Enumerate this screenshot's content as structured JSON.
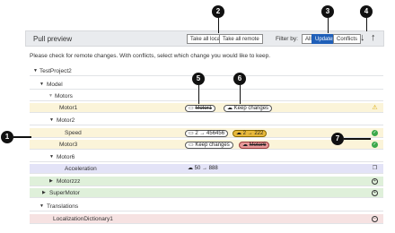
{
  "toolbar": {
    "title": "Pull preview",
    "take_all_local": "Take all local",
    "take_all_remote": "Take all remote",
    "filter_label": "Filter by:",
    "filters": [
      "All",
      "Updates",
      "Conflicts"
    ],
    "active_filter": "Updates",
    "down_arrow": "↓",
    "up_arrow": "↑"
  },
  "info_text": "Please check for remote changes. With conflicts, select which change you would like to keep.",
  "rows": [
    {
      "label": "TestProject2"
    },
    {
      "label": "Model"
    },
    {
      "label": "Motors"
    },
    {
      "label": "Motor1",
      "keep_local": "Motor1",
      "keep_changes": "Keep changes"
    },
    {
      "label": "Motor2"
    },
    {
      "label": "Speed",
      "local_value": "2 → 456456",
      "remote_value": "2 → 222"
    },
    {
      "label": "Motor3",
      "keep_changes": "Keep changes",
      "keep_remote": "Motor6"
    },
    {
      "label": "Motor6"
    },
    {
      "label": "Acceleration",
      "change": "50 → 888"
    },
    {
      "label": "Motorzzz"
    },
    {
      "label": "SuperMotor"
    },
    {
      "label": "Translations"
    },
    {
      "label": "LocalizationDictionary1"
    }
  ],
  "callouts": [
    "1",
    "2",
    "3",
    "4",
    "5",
    "6",
    "7"
  ],
  "colors": {
    "active_filter": "#1f5fb8",
    "conflict_row": "#fbf4d9",
    "modified_row": "#e3e3f7",
    "added_row": "#dff0da",
    "deleted_row": "#f6e2e2",
    "check": "#3aa84a",
    "warning": "#d8a800",
    "remote_value": "#e8b93c",
    "remote_pick": "#e89a9a"
  },
  "icons": [
    "chevron-down-icon",
    "chevron-right-icon",
    "laptop-icon",
    "cloud-icon",
    "warning-icon",
    "check-circle-icon",
    "plus-circle-icon",
    "minus-circle-icon",
    "pages-icon"
  ]
}
